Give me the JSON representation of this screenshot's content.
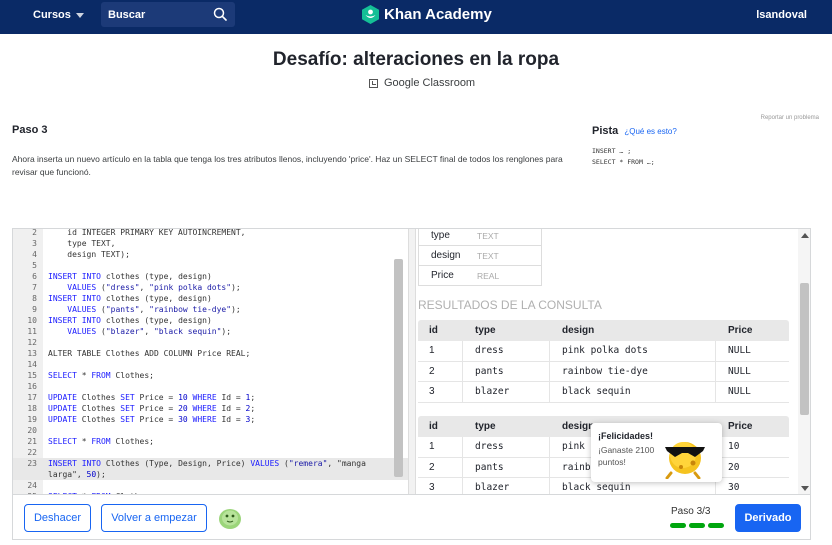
{
  "topbar": {
    "cursos_label": "Cursos",
    "search_placeholder": "Buscar",
    "brand": "Khan Academy",
    "username": "lsandoval"
  },
  "header": {
    "title": "Desafío: alteraciones en la ropa",
    "classroom": "Google Classroom",
    "report": "Reportar un problema"
  },
  "step": {
    "label": "Paso 3",
    "instructions": "Ahora inserta un nuevo artículo en la tabla que tenga los tres atributos llenos, incluyendo 'price'. Haz un SELECT final de todos los renglones para revisar que funcionó."
  },
  "hint": {
    "label": "Pista",
    "link": "¿Qué es esto?",
    "code": "INSERT … ;\nSELECT * FROM …;"
  },
  "editor": {
    "lines": [
      {
        "n": "2",
        "text": "    id INTEGER PRIMARY KEY AUTOINCREMENT,"
      },
      {
        "n": "3",
        "text": "    type TEXT,"
      },
      {
        "n": "4",
        "text": "    design TEXT);"
      },
      {
        "n": "5",
        "text": ""
      },
      {
        "n": "6",
        "text": "INSERT INTO clothes (type, design)"
      },
      {
        "n": "7",
        "text": "    VALUES (\"dress\", \"pink polka dots\");"
      },
      {
        "n": "8",
        "text": "INSERT INTO clothes (type, design)"
      },
      {
        "n": "9",
        "text": "    VALUES (\"pants\", \"rainbow tie-dye\");"
      },
      {
        "n": "10",
        "text": "INSERT INTO clothes (type, design)"
      },
      {
        "n": "11",
        "text": "    VALUES (\"blazer\", \"black sequin\");"
      },
      {
        "n": "12",
        "text": ""
      },
      {
        "n": "13",
        "text": "ALTER TABLE Clothes ADD COLUMN Price REAL;"
      },
      {
        "n": "14",
        "text": ""
      },
      {
        "n": "15",
        "text": "SELECT * FROM Clothes;"
      },
      {
        "n": "16",
        "text": ""
      },
      {
        "n": "17",
        "text": "UPDATE Clothes SET Price = 10 WHERE Id = 1;"
      },
      {
        "n": "18",
        "text": "UPDATE Clothes SET Price = 20 WHERE Id = 2;"
      },
      {
        "n": "19",
        "text": "UPDATE Clothes SET Price = 30 WHERE Id = 3;"
      },
      {
        "n": "20",
        "text": ""
      },
      {
        "n": "21",
        "text": "SELECT * FROM Clothes;"
      },
      {
        "n": "22",
        "text": ""
      },
      {
        "n": "23",
        "text": "INSERT INTO Clothes (Type, Design, Price) VALUES (\"remera\", \"manga"
      },
      {
        "n": "",
        "text": "larga\", 50);"
      },
      {
        "n": "24",
        "text": ""
      },
      {
        "n": "25",
        "text": "SELECT * FROM Clothes;"
      }
    ]
  },
  "schema": [
    {
      "name": "type",
      "type": "TEXT"
    },
    {
      "name": "design",
      "type": "TEXT"
    },
    {
      "name": "Price",
      "type": "REAL"
    }
  ],
  "results": {
    "title": "RESULTADOS DE LA CONSULTA",
    "headers": [
      "id",
      "type",
      "design",
      "Price"
    ],
    "table1": [
      [
        "1",
        "dress",
        "pink polka dots",
        "NULL"
      ],
      [
        "2",
        "pants",
        "rainbow tie-dye",
        "NULL"
      ],
      [
        "3",
        "blazer",
        "black sequin",
        "NULL"
      ]
    ],
    "table2": [
      [
        "1",
        "dress",
        "pink",
        "10"
      ],
      [
        "2",
        "pants",
        "rainb",
        "20"
      ],
      [
        "3",
        "blazer",
        "black sequin",
        "30"
      ]
    ]
  },
  "toast": {
    "title": "¡Felicidades!",
    "body": "¡Ganaste 2100 puntos!"
  },
  "footer": {
    "undo": "Deshacer",
    "restart": "Volver a empezar",
    "progress_label": "Paso 3/3",
    "progress_done": 3,
    "progress_total": 3,
    "next": "Derivado"
  },
  "colors": {
    "navy": "#0a2a66",
    "blue": "#1865f2",
    "green": "#00a60e"
  }
}
